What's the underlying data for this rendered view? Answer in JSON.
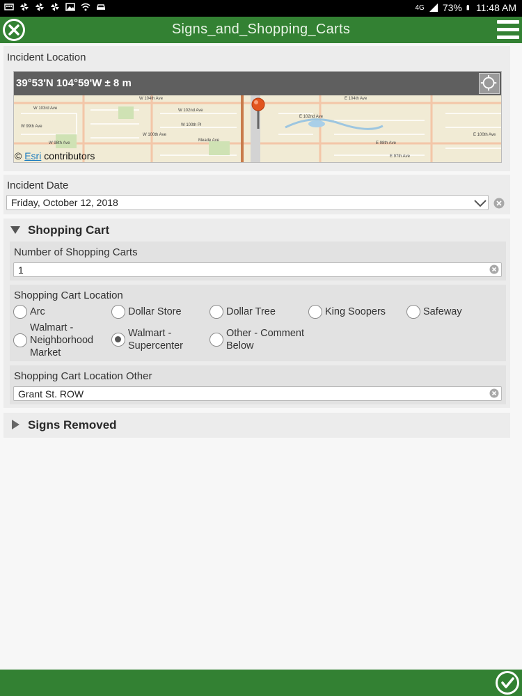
{
  "status_bar": {
    "battery": "73%",
    "network": "4G",
    "time": "11:48 AM"
  },
  "app": {
    "title": "Signs_and_Shopping_Carts"
  },
  "incident_location": {
    "label": "Incident Location",
    "coordinates": "39°53'N 104°59'W ± 8 m",
    "attribution_prefix": "©",
    "attribution_link": "Esri",
    "attribution_suffix": "contributors",
    "map_streets": [
      "W 103rd Ave",
      "W 104th Ave",
      "W 102nd Ave",
      "W 100th Pl",
      "W 100th Ave",
      "W 99th Ave",
      "W 98th Ave",
      "Meade Ave",
      "E 104th Ave",
      "E 102nd Ave",
      "E 100th Ave",
      "E 98th Ave",
      "E 97th Ave"
    ]
  },
  "incident_date": {
    "label": "Incident Date",
    "value": "Friday, October 12, 2018"
  },
  "shopping_cart": {
    "header": "Shopping Cart",
    "count_label": "Number of Shopping Carts",
    "count_value": "1",
    "location_label": "Shopping Cart Location",
    "options": [
      {
        "label": "Arc",
        "checked": false
      },
      {
        "label": "Dollar Store",
        "checked": false
      },
      {
        "label": "Dollar Tree",
        "checked": false
      },
      {
        "label": "King Soopers",
        "checked": false
      },
      {
        "label": "Safeway",
        "checked": false
      },
      {
        "label": "Walmart - Neighborhood Market",
        "checked": false
      },
      {
        "label": "Walmart - Supercenter",
        "checked": true
      },
      {
        "label": "Other - Comment Below",
        "checked": false
      }
    ],
    "location_other_label": "Shopping Cart Location Other",
    "location_other_value": "Grant St. ROW"
  },
  "signs_removed": {
    "header": "Signs Removed"
  },
  "colors": {
    "primary_green": "#338133",
    "panel_gray": "#ececec"
  }
}
